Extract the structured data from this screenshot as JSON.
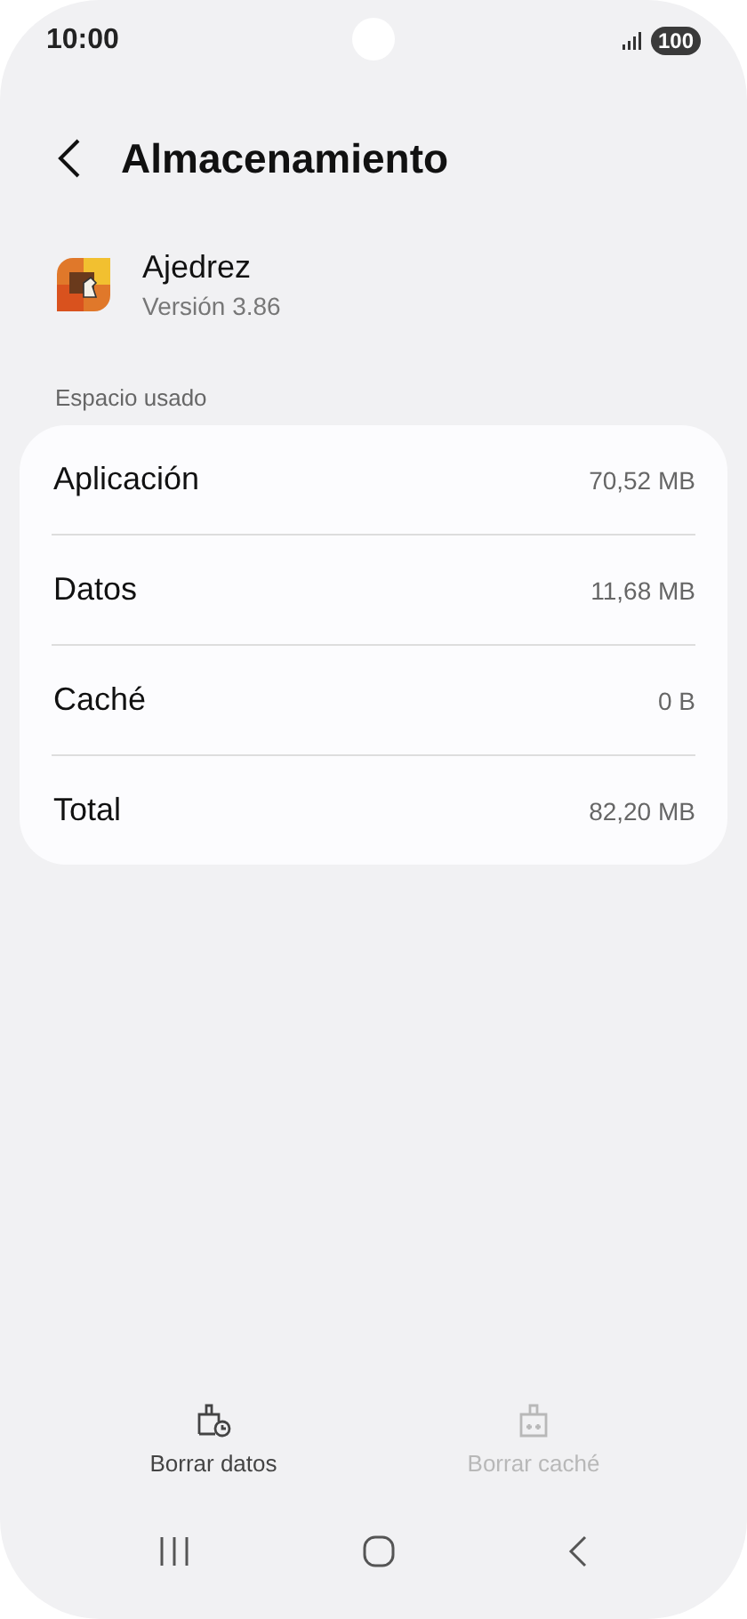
{
  "status_bar": {
    "time": "10:00",
    "battery": "100"
  },
  "header": {
    "title": "Almacenamiento"
  },
  "app": {
    "name": "Ajedrez",
    "version": "Versión 3.86"
  },
  "section": {
    "label": "Espacio usado"
  },
  "rows": [
    {
      "label": "Aplicación",
      "value": "70,52 MB"
    },
    {
      "label": "Datos",
      "value": "11,68 MB"
    },
    {
      "label": "Caché",
      "value": "0 B"
    },
    {
      "label": "Total",
      "value": "82,20 MB"
    }
  ],
  "actions": [
    {
      "kind": "clear-data",
      "label": "Borrar datos",
      "disabled": false
    },
    {
      "kind": "clear-cache",
      "label": "Borrar caché",
      "disabled": true
    }
  ]
}
